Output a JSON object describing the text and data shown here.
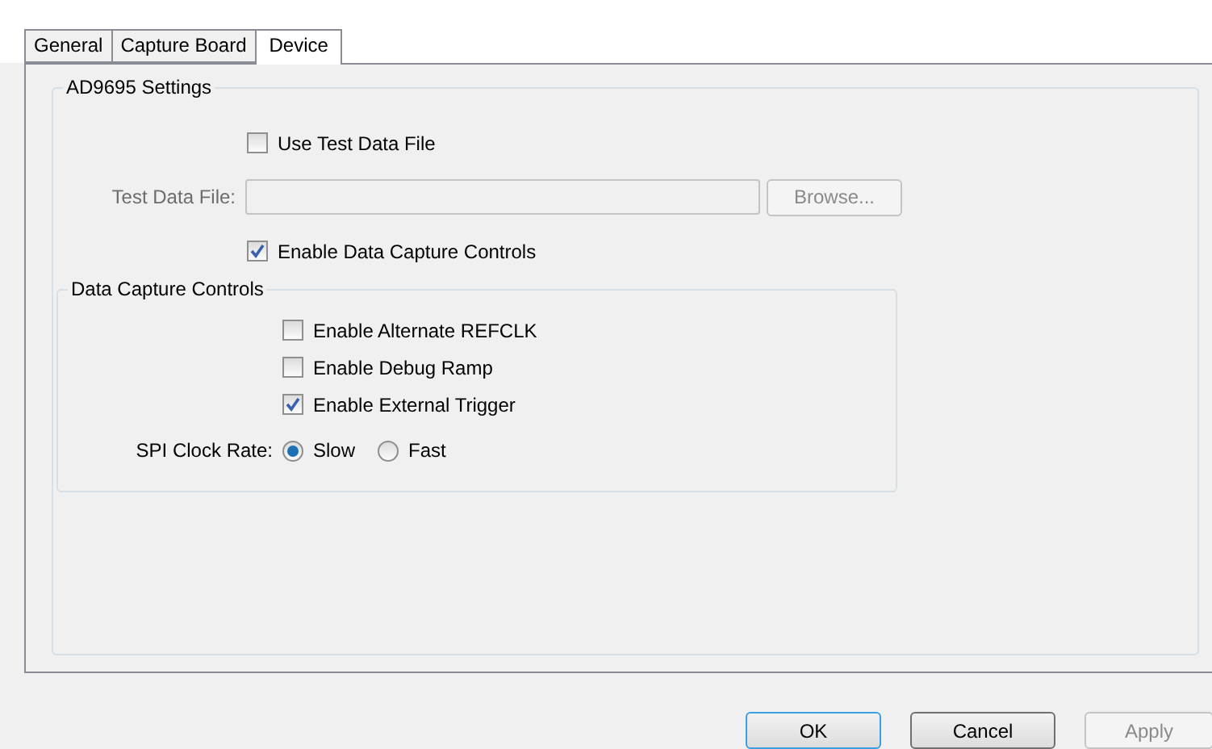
{
  "tabs": [
    {
      "label": "General",
      "selected": false
    },
    {
      "label": "Capture Board",
      "selected": false
    },
    {
      "label": "Device",
      "selected": true
    }
  ],
  "settings_group": {
    "title": "AD9695 Settings",
    "use_test_data_file": {
      "label": "Use Test Data File",
      "checked": false
    },
    "test_data_file": {
      "label": "Test Data File:",
      "disabled": true
    },
    "browse_button": {
      "label": "Browse...",
      "disabled": true
    },
    "enable_data_capture_controls": {
      "label": "Enable Data Capture Controls",
      "checked": true
    }
  },
  "capture_group": {
    "title": "Data Capture Controls",
    "checkboxes": [
      {
        "label": "Enable Alternate REFCLK",
        "checked": false
      },
      {
        "label": "Enable Debug Ramp",
        "checked": false
      },
      {
        "label": "Enable External Trigger",
        "checked": true
      }
    ],
    "spi_clock_rate": {
      "label": "SPI Clock Rate:",
      "options": [
        {
          "label": "Slow",
          "selected": true
        },
        {
          "label": "Fast",
          "selected": false
        }
      ]
    }
  },
  "buttons": [
    {
      "label": "OK",
      "default": true,
      "disabled": false
    },
    {
      "label": "Cancel",
      "default": false,
      "disabled": false
    },
    {
      "label": "Apply",
      "default": false,
      "disabled": true
    }
  ]
}
